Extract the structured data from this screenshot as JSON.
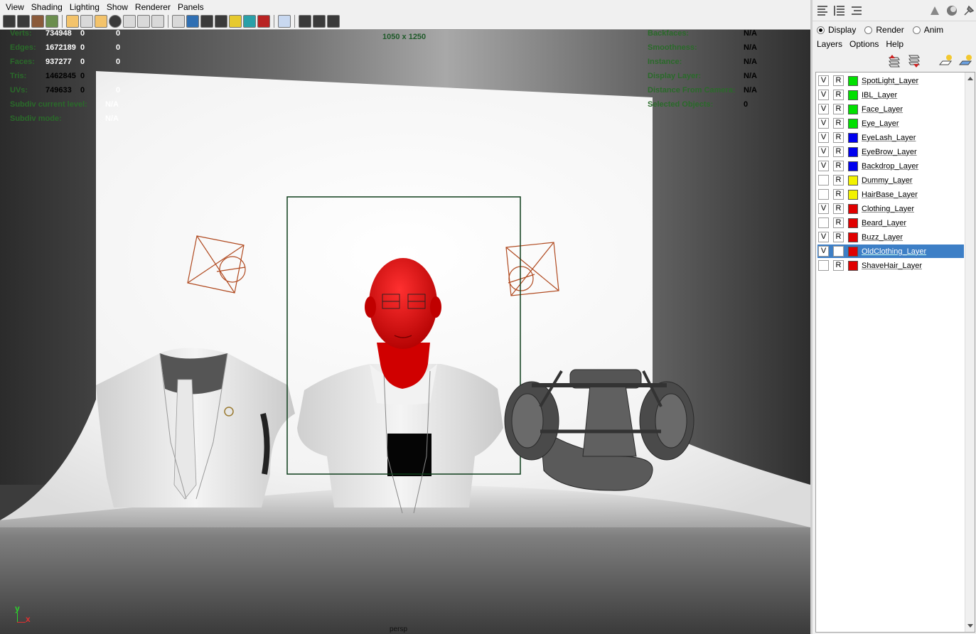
{
  "menubar": {
    "items": [
      "View",
      "Shading",
      "Lighting",
      "Show",
      "Renderer",
      "Panels"
    ]
  },
  "hud_left": [
    {
      "label": "Verts:",
      "a": "734948",
      "b": "0",
      "c": "0"
    },
    {
      "label": "Edges:",
      "a": "1672189",
      "b": "0",
      "c": "0"
    },
    {
      "label": "Faces:",
      "a": "937277",
      "b": "0",
      "c": "0"
    },
    {
      "label": "Tris:",
      "a": "1462845",
      "b": "0",
      "c": ""
    },
    {
      "label": "UVs:",
      "a": "749633",
      "b": "0",
      "c": "0"
    },
    {
      "label": "Subdiv current level:",
      "a": "",
      "b": "N/A",
      "c": ""
    },
    {
      "label": "Subdiv mode:",
      "a": "",
      "b": "N/A",
      "c": ""
    }
  ],
  "hud_center": {
    "resolution": "1050 x 1250"
  },
  "hud_right": [
    {
      "label": "Backfaces:",
      "value": "N/A"
    },
    {
      "label": "Smoothness:",
      "value": "N/A"
    },
    {
      "label": "Instance:",
      "value": "N/A"
    },
    {
      "label": "Display Layer:",
      "value": "N/A"
    },
    {
      "label": "Distance From Camera:",
      "value": "N/A"
    },
    {
      "label": "Selected Objects:",
      "value": "0"
    }
  ],
  "axis": {
    "y": "y",
    "x": "x"
  },
  "bottom_label": "persp",
  "panel": {
    "modes": {
      "display": "Display",
      "render": "Render",
      "anim": "Anim",
      "selected": "display"
    },
    "menu": [
      "Layers",
      "Options",
      "Help"
    ],
    "layers": [
      {
        "v": "V",
        "r": "R",
        "color": "#00e000",
        "name": "SpotLight_Layer",
        "selected": false
      },
      {
        "v": "V",
        "r": "R",
        "color": "#00e000",
        "name": "IBL_Layer",
        "selected": false
      },
      {
        "v": "V",
        "r": "R",
        "color": "#00e000",
        "name": "Face_Layer",
        "selected": false
      },
      {
        "v": "V",
        "r": "R",
        "color": "#00e000",
        "name": "Eye_Layer",
        "selected": false
      },
      {
        "v": "V",
        "r": "R",
        "color": "#0000ee",
        "name": "EyeLash_Layer",
        "selected": false
      },
      {
        "v": "V",
        "r": "R",
        "color": "#0000ee",
        "name": "EyeBrow_Layer",
        "selected": false
      },
      {
        "v": "V",
        "r": "R",
        "color": "#0000ee",
        "name": "Backdrop_Layer",
        "selected": false
      },
      {
        "v": "",
        "r": "R",
        "color": "#f2f200",
        "name": "Dummy_Layer",
        "selected": false
      },
      {
        "v": "",
        "r": "R",
        "color": "#f2f200",
        "name": "HairBase_Layer",
        "selected": false
      },
      {
        "v": "V",
        "r": "R",
        "color": "#e00000",
        "name": "Clothing_Layer",
        "selected": false
      },
      {
        "v": "",
        "r": "R",
        "color": "#e00000",
        "name": "Beard_Layer",
        "selected": false
      },
      {
        "v": "V",
        "r": "R",
        "color": "#e00000",
        "name": "Buzz_Layer",
        "selected": false
      },
      {
        "v": "V",
        "r": "",
        "color": "#e00000",
        "name": "OldClothing_Layer",
        "selected": true
      },
      {
        "v": "",
        "r": "R",
        "color": "#e00000",
        "name": "ShaveHair_Layer",
        "selected": false
      }
    ]
  },
  "colors": {
    "selection": "#3d7fc6",
    "hud_label": "#2a6a2a",
    "camera_gate": "#0d3d1a",
    "light_gizmo": "#b04a20",
    "selected_mesh": "#e00000"
  }
}
